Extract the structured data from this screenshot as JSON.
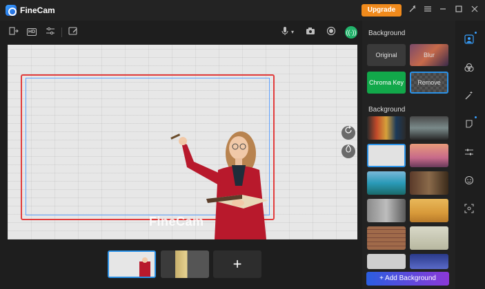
{
  "app": {
    "title": "FineCam",
    "upgrade_label": "Upgrade"
  },
  "titlebar_icons": [
    "wand-icon",
    "menu-icon",
    "minimize-icon",
    "maximize-icon",
    "close-icon"
  ],
  "preview": {
    "watermark": "FineCam"
  },
  "thumbnails": {
    "add_label": "+"
  },
  "panel": {
    "section_mode": "Background",
    "modes": [
      "Original",
      "Blur",
      "Chroma Key",
      "Remove"
    ],
    "section_backgrounds": "Background",
    "add_background_label": "+ Add Background"
  },
  "colors": {
    "accent": "#2a92e8",
    "upgrade": "#f08a1c",
    "chroma": "#12a84a",
    "frame": "#e23b3b",
    "live": "#22b36b"
  }
}
